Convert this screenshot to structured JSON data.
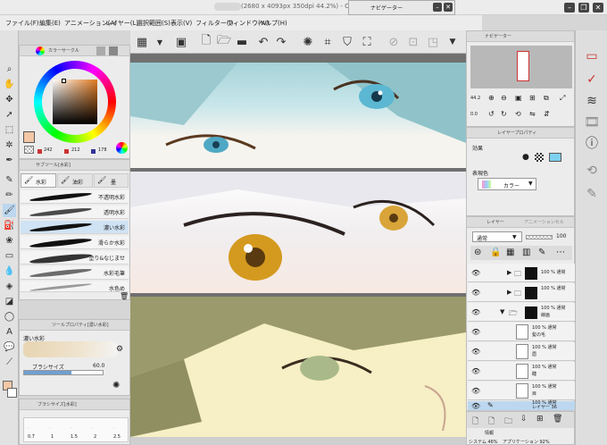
{
  "window": {
    "title": "(2680 x 4093px 350dpi 44.2%) - CL",
    "minimize": "–",
    "restore": "❐",
    "close": "✕"
  },
  "navigator_window": {
    "title": "ナビゲーター",
    "close": "✕"
  },
  "menu": [
    "ファイル(F)",
    "編集(E)",
    "アニメーション(A)",
    "レイヤー(L)",
    "選択範囲(S)",
    "表示(V)",
    "フィルター(I)",
    "ウィンドウ(W)",
    "ヘルプ(H)"
  ],
  "color_panel": {
    "tab_label": "カラーサークル",
    "h": "242",
    "s": "212",
    "v": "178",
    "hsv": [
      "H",
      "S",
      "V"
    ],
    "current_color": "#f4c7a6",
    "hue_color": "#e07a20"
  },
  "subtool_panel": {
    "tab_label": "サブツール[水彩]",
    "groups": [
      "水彩",
      "油彩",
      "墨"
    ],
    "brushes": [
      "不透明水彩",
      "透明水彩",
      "濃い水彩",
      "滑らか水彩",
      "塗り&なじませ",
      "水彩毛筆",
      "水色め"
    ]
  },
  "tool_property": {
    "tab_label": "ツールプロパティ[濃い水彩]",
    "tool_name": "濃い水彩",
    "brush_size_label": "ブラシサイズ",
    "brush_size_value": "60.0"
  },
  "brush_size_panel": {
    "tab_label": "ブラシサイズ[水彩]",
    "sizes": [
      "0.7",
      "1",
      "1.5",
      "2",
      "2.5"
    ]
  },
  "navigator_panel": {
    "tab_label": "ナビゲーター",
    "zoom": "44.2",
    "angle": "0.0"
  },
  "layer_property": {
    "tab_label": "レイヤープロパティ",
    "effect_label": "効果",
    "expression_label": "表現色",
    "expression_value": "カラー"
  },
  "layer_panel": {
    "tab_label": "レイヤー",
    "tab2_label": "アニメーションセル",
    "blend_mode": "通常",
    "opacity": "100",
    "layers": [
      {
        "opacity": "100 %",
        "mode": "通常",
        "name": ""
      },
      {
        "opacity": "100 %",
        "mode": "通常",
        "name": ""
      },
      {
        "opacity": "100 %",
        "mode": "通常",
        "name": "線画"
      },
      {
        "opacity": "100 %",
        "mode": "通常",
        "name": "髪の毛"
      },
      {
        "opacity": "100 %",
        "mode": "通常",
        "name": "眉"
      },
      {
        "opacity": "100 %",
        "mode": "通常",
        "name": "睫"
      },
      {
        "opacity": "100 %",
        "mode": "通常",
        "name": "目"
      },
      {
        "opacity": "100 %",
        "mode": "通常",
        "name": "レイヤー 36"
      }
    ]
  },
  "info_panel": {
    "tab_label": "情報",
    "system": "システム 46%",
    "application": "アプリケーション 92%"
  }
}
